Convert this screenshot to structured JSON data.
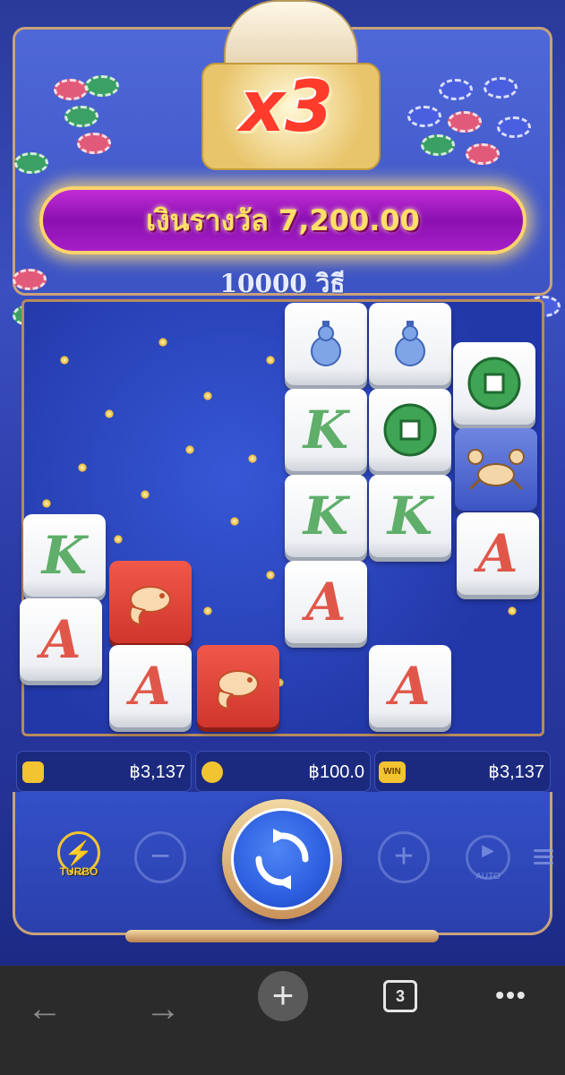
{
  "header": {
    "multiplier": "x3",
    "win_label": "เงินรางวัล 7,200.00",
    "ways_label": "10000 วิธี"
  },
  "reels": [
    [
      "K",
      "A"
    ],
    [
      "koi",
      "A"
    ],
    [
      "koi"
    ],
    [
      "gourd",
      "K",
      "K",
      "A"
    ],
    [
      "gourd",
      "coin",
      "K",
      "A"
    ],
    [
      "coin",
      "crab",
      "A"
    ]
  ],
  "balances": {
    "wallet_value": "฿3,137",
    "bet_value": "฿100.0",
    "win_value": "฿3,137",
    "win_icon_label": "WIN"
  },
  "controls": {
    "turbo_label": "TURBO",
    "minus_glyph": "−",
    "plus_glyph": "+",
    "auto_label": "AUTO"
  },
  "browser": {
    "back_glyph": "←",
    "forward_glyph": "→",
    "new_tab_glyph": "+",
    "tab_count": "3",
    "more_glyph": "•••"
  },
  "colors": {
    "win_banner": "#a61ec8",
    "win_text": "#ffe066",
    "letter_a": "#e0574a",
    "letter_k": "#5fae6a",
    "spin_button": "#2d5fe0",
    "turbo": "#f2c431"
  }
}
